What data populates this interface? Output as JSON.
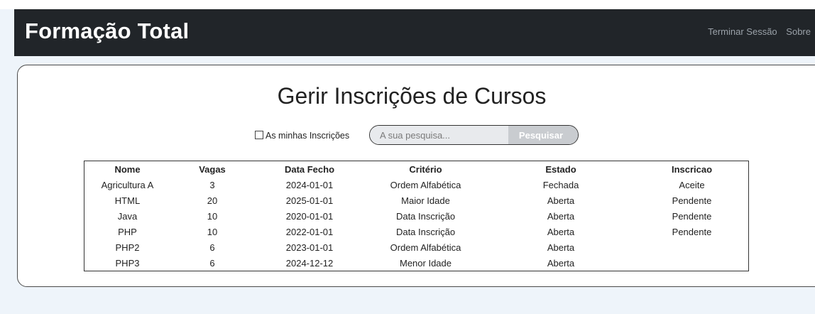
{
  "header": {
    "brand": "Formação Total",
    "links": [
      "Terminar Sessão",
      "Sobre"
    ]
  },
  "page": {
    "title": "Gerir Inscrições de Cursos"
  },
  "filters": {
    "my_enrollments_label": "As minhas Inscrições",
    "my_enrollments_checked": false,
    "search_placeholder": "A sua pesquisa...",
    "search_value": "",
    "search_button": "Pesquisar"
  },
  "table": {
    "columns": [
      "Nome",
      "Vagas",
      "Data Fecho",
      "Critério",
      "Estado",
      "Inscricao"
    ],
    "rows": [
      [
        "Agricultura A",
        "3",
        "2024-01-01",
        "Ordem Alfabética",
        "Fechada",
        "Aceite"
      ],
      [
        "HTML",
        "20",
        "2025-01-01",
        "Maior Idade",
        "Aberta",
        "Pendente"
      ],
      [
        "Java",
        "10",
        "2020-01-01",
        "Data Inscrição",
        "Aberta",
        "Pendente"
      ],
      [
        "PHP",
        "10",
        "2022-01-01",
        "Data Inscrição",
        "Aberta",
        "Pendente"
      ],
      [
        "PHP2",
        "6",
        "2023-01-01",
        "Ordem Alfabética",
        "Aberta",
        ""
      ],
      [
        "PHP3",
        "6",
        "2024-12-12",
        "Menor Idade",
        "Aberta",
        ""
      ]
    ]
  },
  "colors": {
    "navbar": "#212529",
    "page_background": "#eef4fa",
    "nav_link": "#9aa1a8"
  }
}
